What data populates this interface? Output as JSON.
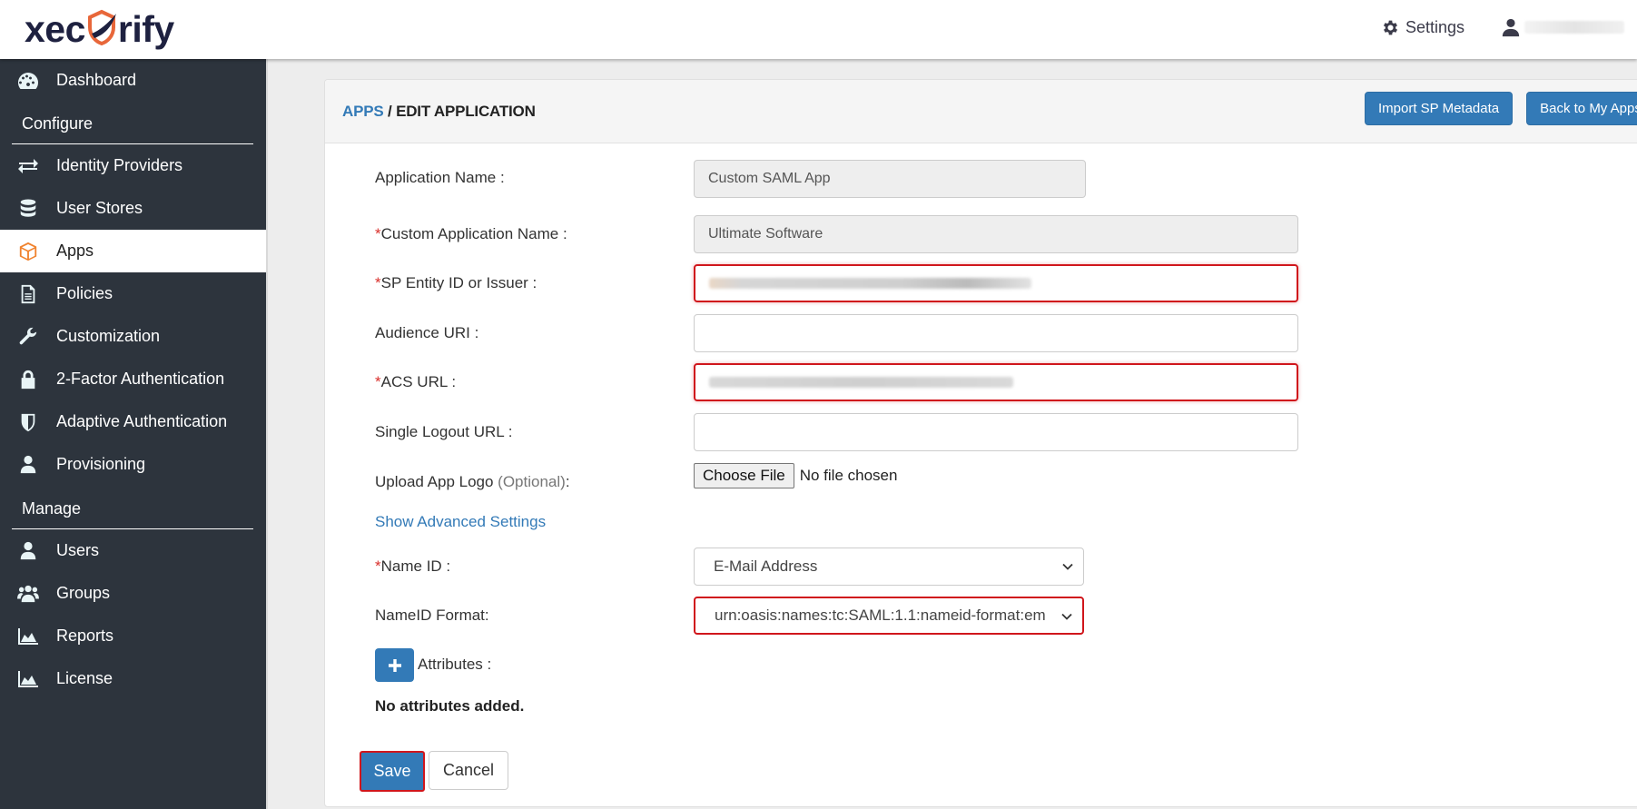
{
  "header": {
    "brand": {
      "pre": "xec",
      "post": "rify"
    },
    "settings_label": "Settings",
    "user_name_redacted": true
  },
  "sidebar": {
    "items": [
      {
        "type": "item",
        "label": "Dashboard",
        "icon": "dashboard-icon"
      },
      {
        "type": "section",
        "label": "Configure"
      },
      {
        "type": "item",
        "label": "Identity Providers",
        "icon": "exchange-icon"
      },
      {
        "type": "item",
        "label": "User Stores",
        "icon": "database-icon"
      },
      {
        "type": "item",
        "label": "Apps",
        "icon": "cube-icon",
        "active": true
      },
      {
        "type": "item",
        "label": "Policies",
        "icon": "document-icon"
      },
      {
        "type": "item",
        "label": "Customization",
        "icon": "wrench-icon"
      },
      {
        "type": "item",
        "label": "2-Factor Authentication",
        "icon": "lock-icon"
      },
      {
        "type": "item",
        "label": "Adaptive Authentication",
        "icon": "shield-icon"
      },
      {
        "type": "item",
        "label": "Provisioning",
        "icon": "user-icon"
      },
      {
        "type": "section",
        "label": "Manage"
      },
      {
        "type": "item",
        "label": "Users",
        "icon": "user-icon"
      },
      {
        "type": "item",
        "label": "Groups",
        "icon": "group-icon"
      },
      {
        "type": "item",
        "label": "Reports",
        "icon": "area-chart-icon"
      },
      {
        "type": "item",
        "label": "License",
        "icon": "area-chart-icon"
      }
    ]
  },
  "panel": {
    "breadcrumb": {
      "parent": "APPS",
      "separator": " / ",
      "current": "EDIT APPLICATION"
    },
    "buttons": {
      "import": "Import SP Metadata",
      "back": "Back to My Apps"
    }
  },
  "form": {
    "application_name": {
      "label": "Application Name :",
      "value": "Custom SAML App"
    },
    "custom_app_name": {
      "required_mark": "*",
      "label": "Custom Application Name :",
      "value": "Ultimate Software"
    },
    "sp_entity_id": {
      "required_mark": "*",
      "label": "SP Entity ID or Issuer :",
      "value_redacted": true
    },
    "audience_uri": {
      "label": "Audience URI :",
      "value": ""
    },
    "acs_url": {
      "required_mark": "*",
      "label": "ACS URL :",
      "value_redacted": true
    },
    "single_logout_url": {
      "label": "Single Logout URL :",
      "value": ""
    },
    "upload_logo": {
      "label": "Upload App Logo ",
      "optional": "(Optional)",
      "suffix": ":",
      "button": "Choose File",
      "status": "No file chosen"
    },
    "advanced_link": "Show Advanced Settings",
    "name_id": {
      "required_mark": "*",
      "label": "Name ID :",
      "value": "E-Mail Address"
    },
    "nameid_format": {
      "label": "NameID Format:",
      "value": "urn:oasis:names:tc:SAML:1.1:nameid-format:em"
    },
    "attributes": {
      "label": "Attributes :",
      "empty": "No attributes added."
    },
    "save": "Save",
    "cancel": "Cancel"
  },
  "colors": {
    "primary": "#337ab7",
    "sidebar": "#2d343d",
    "highlight": "#d0161c",
    "accent": "#f0822d"
  }
}
